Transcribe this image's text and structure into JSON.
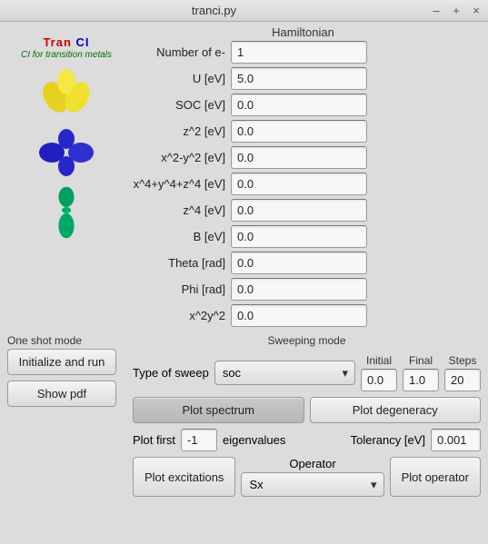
{
  "window": {
    "title": "tranci.py",
    "minimize": "–",
    "maximize": "+",
    "close": "×"
  },
  "logo": {
    "part1": "Tran",
    "part2": " CI",
    "subtitle": "CI for transition metals"
  },
  "hamiltonian": {
    "title": "Hamiltonian",
    "fields": [
      {
        "label": "Number of e-",
        "value": "1"
      },
      {
        "label": "U [eV]",
        "value": "5.0"
      },
      {
        "label": "SOC [eV]",
        "value": "0.0"
      },
      {
        "label": "z^2 [eV]",
        "value": "0.0"
      },
      {
        "label": "x^2-y^2 [eV]",
        "value": "0.0"
      },
      {
        "label": "x^4+y^4+z^4 [eV]",
        "value": "0.0"
      },
      {
        "label": "z^4 [eV]",
        "value": "0.0"
      },
      {
        "label": "B [eV]",
        "value": "0.0"
      },
      {
        "label": "Theta [rad]",
        "value": "0.0"
      },
      {
        "label": "Phi [rad]",
        "value": "0.0"
      },
      {
        "label": "x^2y^2",
        "value": "0.0"
      }
    ]
  },
  "oneshot": {
    "title": "One shot mode",
    "init": "Initialize and run",
    "pdf": "Show pdf"
  },
  "sweep": {
    "title": "Sweeping mode",
    "type_label": "Type of sweep",
    "type_value": "soc",
    "initial_label": "Initial",
    "initial": "0.0",
    "final_label": "Final",
    "final": "1.0",
    "steps_label": "Steps",
    "steps": "20",
    "plot_spectrum": "Plot spectrum",
    "plot_degeneracy": "Plot degeneracy",
    "plot_first_label": "Plot first",
    "plot_first": "-1",
    "eigen_label": "eigenvalues",
    "tolerancy_label": "Tolerancy [eV]",
    "tolerancy": "0.001",
    "plot_excitations": "Plot excitations",
    "operator_label": "Operator",
    "operator_value": "Sx",
    "plot_operator": "Plot operator"
  }
}
